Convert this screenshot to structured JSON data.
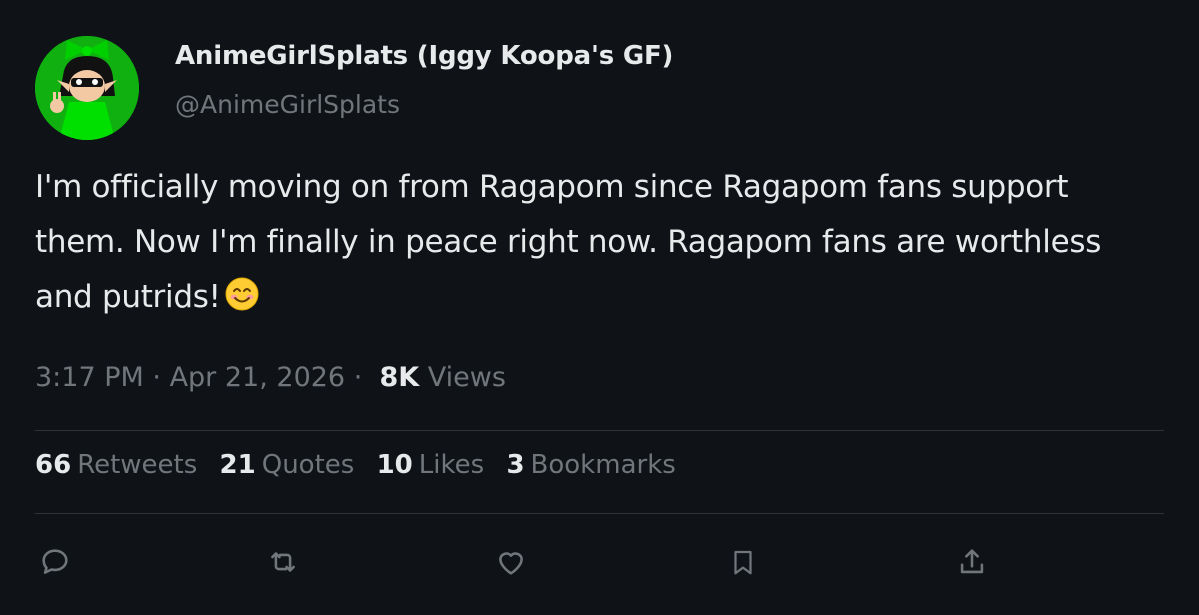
{
  "author": {
    "display_name": "AnimeGirlSplats (Iggy Koopa's GF)",
    "handle": "@AnimeGirlSplats"
  },
  "tweet": {
    "text": "I'm officially moving on from Ragapom since Ragapom fans support them. Now I'm finally in peace right now. Ragapom fans are worthless and putrids!",
    "emoji": "smiling-face-emoji"
  },
  "meta": {
    "time": "3:17 PM",
    "separator": "·",
    "date": "Apr 21, 2026",
    "views_count": "8K",
    "views_label": "Views"
  },
  "stats": {
    "retweets": {
      "count": "66",
      "label": "Retweets"
    },
    "quotes": {
      "count": "21",
      "label": "Quotes"
    },
    "likes": {
      "count": "10",
      "label": "Likes"
    },
    "bookmarks": {
      "count": "3",
      "label": "Bookmarks"
    }
  },
  "actions": [
    "reply-icon",
    "retweet-icon",
    "like-icon",
    "bookmark-icon",
    "share-icon"
  ],
  "colors": {
    "background": "#0f1318",
    "primary_text": "#e7e9ea",
    "secondary_text": "#71767b",
    "divider": "#2f3336",
    "avatar_green": "#0fb00f"
  }
}
